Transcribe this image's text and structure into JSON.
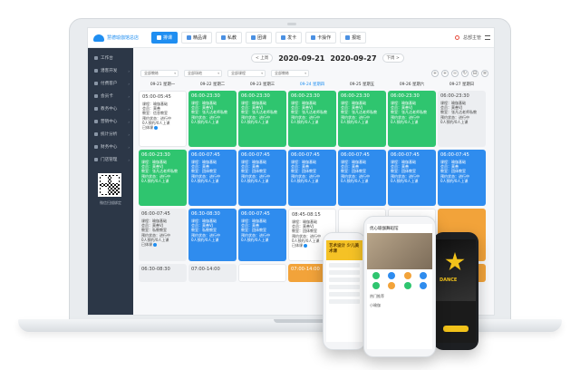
{
  "brand": {
    "name": "慧德瑜伽馆总店"
  },
  "topnav": {
    "tabs": [
      {
        "label": "排课",
        "active": true
      },
      {
        "label": "精品课",
        "active": false
      },
      {
        "label": "私教",
        "active": false
      },
      {
        "label": "团课",
        "active": false
      },
      {
        "label": "发卡",
        "active": false
      },
      {
        "label": "卡操作",
        "active": false
      },
      {
        "label": "报班",
        "active": false
      }
    ],
    "user": "总部主管"
  },
  "sidebar": {
    "items": [
      {
        "label": "工作台"
      },
      {
        "label": "潜客开发",
        "arrow": "›"
      },
      {
        "label": "付费客户",
        "arrow": "›"
      },
      {
        "label": "会员卡",
        "arrow": "›"
      },
      {
        "label": "教务中心",
        "arrow": "›"
      },
      {
        "label": "营销中心",
        "arrow": "›"
      },
      {
        "label": "统计分析",
        "arrow": "›"
      },
      {
        "label": "财务中心",
        "arrow": "›"
      },
      {
        "label": "门店管理",
        "arrow": "›"
      }
    ],
    "qr_caption": "微信扫描绑定"
  },
  "week": {
    "prev": "< 上周",
    "next": "下周 >",
    "start": "2020-09-21",
    "end": "2020-09-27"
  },
  "filters": [
    "全部教练",
    "全部场地",
    "全部课程",
    "全部教练"
  ],
  "tools": [
    "+",
    "+",
    "∞",
    "↻",
    "⊟",
    "≡"
  ],
  "days": [
    {
      "label": "09-21 星期一",
      "today": false
    },
    {
      "label": "09-22 星期二",
      "today": false
    },
    {
      "label": "09-23 星期三",
      "today": false
    },
    {
      "label": "09-24 星期四",
      "today": true
    },
    {
      "label": "09-25 星期五",
      "today": false
    },
    {
      "label": "09-26 星期六",
      "today": false
    },
    {
      "label": "09-27 星期日",
      "today": false
    }
  ],
  "rows": [
    [
      {
        "color": "white",
        "time": "05:00-05:45",
        "lines": [
          "课程：瑜伽基础",
          "会员：莫善",
          "教室：信息教室",
          "预约状态：进行中",
          "0人预约/0人上课"
        ],
        "tag": "已体课"
      },
      {
        "color": "green",
        "time": "06:00-23:30",
        "lines": [
          "课程：瑜伽基础",
          "会员：莫善VJ",
          "教室：张凡达老师私教",
          "预约状态：进行中",
          "0人预约/0人上课"
        ],
        "tag": ""
      },
      {
        "color": "green",
        "time": "06:00-23:30",
        "lines": [
          "课程：瑜伽基础",
          "会员：莫善VJ",
          "教室：张凡达老师私教",
          "预约状态：进行中",
          "0人预约/0人上课"
        ],
        "tag": ""
      },
      {
        "color": "green",
        "time": "06:00-23:30",
        "lines": [
          "课程：瑜伽基础",
          "会员：莫善VJ",
          "教室：张凡达老师私教",
          "预约状态：进行中",
          "0人预约/0人上课"
        ],
        "tag": ""
      },
      {
        "color": "green",
        "time": "06:00-23:30",
        "lines": [
          "课程：瑜伽基础",
          "会员：莫善VJ",
          "教室：张凡达老师私教",
          "预约状态：进行中",
          "0人预约/0人上课"
        ],
        "tag": ""
      },
      {
        "color": "green",
        "time": "06:00-23:30",
        "lines": [
          "课程：瑜伽基础",
          "会员：莫善VJ",
          "教室：张凡达老师私教",
          "预约状态：进行中",
          "0人预约/0人上课"
        ],
        "tag": ""
      },
      {
        "color": "gray",
        "time": "06:00-23:30",
        "lines": [
          "课程：瑜伽基础",
          "会员：莫善VJ",
          "教室：张凡达老师私教",
          "预约状态：进行中",
          "0人预约/0人上课"
        ],
        "tag": ""
      }
    ],
    [
      {
        "color": "green",
        "time": "06:00-23:30",
        "lines": [
          "课程：瑜伽基础",
          "会员：莫善VJ",
          "教室：张凡达老师私教",
          "预约状态：进行中",
          "0人预约/0人上课"
        ],
        "tag": ""
      },
      {
        "color": "blue",
        "time": "06:00-07:45",
        "lines": [
          "课程：瑜伽基础",
          "会员：莫善",
          "教室：团体教室",
          "预约状态：进行中",
          "0人预约/0人上课"
        ],
        "tag": ""
      },
      {
        "color": "blue",
        "time": "06:00-07:45",
        "lines": [
          "课程：瑜伽基础",
          "会员：莫善",
          "教室：团体教室",
          "预约状态：进行中",
          "0人预约/0人上课"
        ],
        "tag": ""
      },
      {
        "color": "blue",
        "time": "06:00-07:45",
        "lines": [
          "课程：瑜伽基础",
          "会员：莫善",
          "教室：团体教室",
          "预约状态：进行中",
          "0人预约/0人上课"
        ],
        "tag": ""
      },
      {
        "color": "blue",
        "time": "06:00-07:45",
        "lines": [
          "课程：瑜伽基础",
          "会员：莫善",
          "教室：团体教室",
          "预约状态：进行中",
          "0人预约/0人上课"
        ],
        "tag": ""
      },
      {
        "color": "blue",
        "time": "06:00-07:45",
        "lines": [
          "课程：瑜伽基础",
          "会员：莫善",
          "教室：团体教室",
          "预约状态：进行中",
          "0人预约/0人上课"
        ],
        "tag": ""
      },
      {
        "color": "blue",
        "time": "06:00-07:45",
        "lines": [
          "课程：瑜伽基础",
          "会员：莫善",
          "教室：团体教室",
          "预约状态：进行中",
          "0人预约/0人上课"
        ],
        "tag": ""
      }
    ],
    [
      {
        "color": "gray",
        "time": "06:00-07:45",
        "lines": [
          "课程：瑜伽基础",
          "会员：莫善VJ",
          "教室：私教教室",
          "预约状态：进行中",
          "0人预约/0人上课"
        ],
        "tag": "已体课"
      },
      {
        "color": "blue",
        "time": "06:30-08:30",
        "lines": [
          "课程：瑜伽基础",
          "会员：莫善VJ",
          "教室：私教教室",
          "预约状态：进行中",
          "0人预约/0人上课"
        ],
        "tag": ""
      },
      {
        "color": "blue",
        "time": "06:00-07:45",
        "lines": [
          "课程：瑜伽基础",
          "会员：莫善",
          "教室：团体教室",
          "预约状态：进行中",
          "0人预约/0人上课"
        ],
        "tag": ""
      },
      {
        "color": "white",
        "time": "08:45-08:15",
        "lines": [
          "课程：瑜伽基础",
          "会员：莫善VJ",
          "教室：团体教室",
          "预约状态：进行中",
          "0人预约/0人上课"
        ],
        "tag": "已体课"
      },
      {
        "color": "white",
        "time": "",
        "lines": [],
        "tag": ""
      },
      {
        "color": "white",
        "time": "",
        "lines": [],
        "tag": ""
      },
      {
        "color": "orange",
        "time": "",
        "lines": [],
        "tag": ""
      }
    ],
    [
      {
        "color": "gray",
        "time": "06:30-08:30",
        "lines": [],
        "tag": ""
      },
      {
        "color": "gray",
        "time": "07:00-14:00",
        "lines": [],
        "tag": ""
      },
      {
        "color": "white",
        "time": "",
        "lines": [],
        "tag": ""
      },
      {
        "color": "orange",
        "time": "07:00-14:00",
        "lines": [],
        "tag": ""
      },
      {
        "color": "white",
        "time": "",
        "lines": [],
        "tag": ""
      },
      {
        "color": "white",
        "time": "",
        "lines": [],
        "tag": ""
      },
      {
        "color": "orange",
        "time": "",
        "lines": [],
        "tag": ""
      }
    ]
  ],
  "phones": {
    "left": {
      "banner": "艺术设计 少儿美术课"
    },
    "center": {
      "title": "优心瑜伽舞蹈馆",
      "section": "热门推荐",
      "profile": "小瑜伽"
    },
    "right": {
      "poster": "DANCE"
    }
  }
}
